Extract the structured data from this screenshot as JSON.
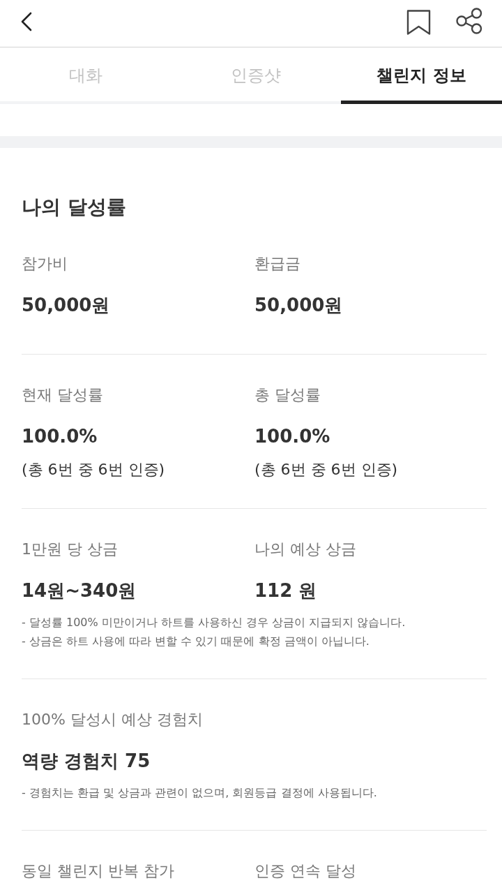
{
  "tabs": [
    {
      "label": "대화",
      "selected": false
    },
    {
      "label": "인증샷",
      "selected": false
    },
    {
      "label": "챌린지 정보",
      "selected": true
    }
  ],
  "summary": {
    "title": "나의 달성률",
    "groups": [
      {
        "items": [
          {
            "label": "참가비",
            "value": "50,000원"
          },
          {
            "label": "환급금",
            "value": "50,000원"
          }
        ]
      },
      {
        "items": [
          {
            "label": "현재 달성률",
            "value": "100.0%",
            "detail": "(총 6번 중 6번 인증)"
          },
          {
            "label": "총 달성률",
            "value": "100.0%",
            "detail": "(총 6번 중 6번 인증)"
          }
        ]
      },
      {
        "items": [
          {
            "label": "1만원 당 상금",
            "value": "14원~340원"
          },
          {
            "label": "나의 예상 상금",
            "value": "112 원"
          }
        ],
        "notes": [
          "- 달성률 100% 미만이거나 하트를 사용하신 경우 상금이 지급되지 않습니다.",
          "- 상금은 하트 사용에 따라 변할 수 있기 때문에 확정 금액이 아닙니다."
        ]
      },
      {
        "items": [
          {
            "label": "100% 달성시 예상 경험치",
            "value": "역량 경험치 75"
          }
        ],
        "notes": [
          "- 경험치는 환급 및 상금과 관련이 없으며, 회원등급 결정에 사용됩니다."
        ]
      },
      {
        "items": [
          {
            "label": "동일 챌린지 반복 참가"
          },
          {
            "label": "인증 연속 달성"
          }
        ]
      }
    ]
  }
}
